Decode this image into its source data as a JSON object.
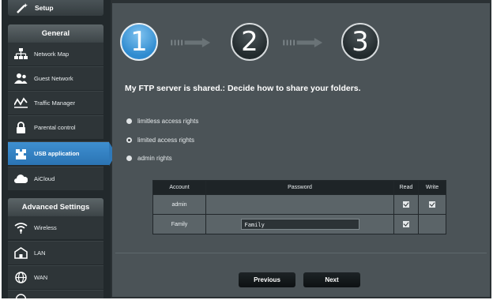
{
  "sidebar": {
    "setup_label": "Setup",
    "general_header": "General",
    "general_items": [
      {
        "label": "Network Map",
        "icon": "network-map-icon"
      },
      {
        "label": "Guest Network",
        "icon": "guest-network-icon"
      },
      {
        "label": "Traffic Manager",
        "icon": "traffic-manager-icon"
      },
      {
        "label": "Parental control",
        "icon": "parental-control-icon"
      },
      {
        "label": "USB application",
        "icon": "usb-application-icon",
        "active": true
      },
      {
        "label": "AiCloud",
        "icon": "aicloud-icon"
      }
    ],
    "advanced_header": "Advanced Settings",
    "advanced_items": [
      {
        "label": "Wireless",
        "icon": "wireless-icon"
      },
      {
        "label": "LAN",
        "icon": "lan-icon"
      },
      {
        "label": "WAN",
        "icon": "wan-icon"
      }
    ]
  },
  "wizard": {
    "steps": [
      "1",
      "2",
      "3"
    ],
    "current_step": 1,
    "title": "My FTP server is shared.: Decide how to share your folders.",
    "options": [
      {
        "label": "limitless access rights",
        "selected": false
      },
      {
        "label": "limited access rights",
        "selected": true
      },
      {
        "label": "admin rights",
        "selected": false
      }
    ],
    "table": {
      "headers": [
        "Account",
        "Password",
        "Read",
        "Write"
      ],
      "rows": [
        {
          "account": "admin",
          "password": "",
          "read": true,
          "write": true
        },
        {
          "account": "Family",
          "password": "Family",
          "read": true,
          "write": false
        }
      ]
    },
    "previous_label": "Previous",
    "next_label": "Next"
  },
  "colors": {
    "accent": "#2f79b9",
    "background": "#4b5357",
    "sidebar": "#22292c"
  }
}
